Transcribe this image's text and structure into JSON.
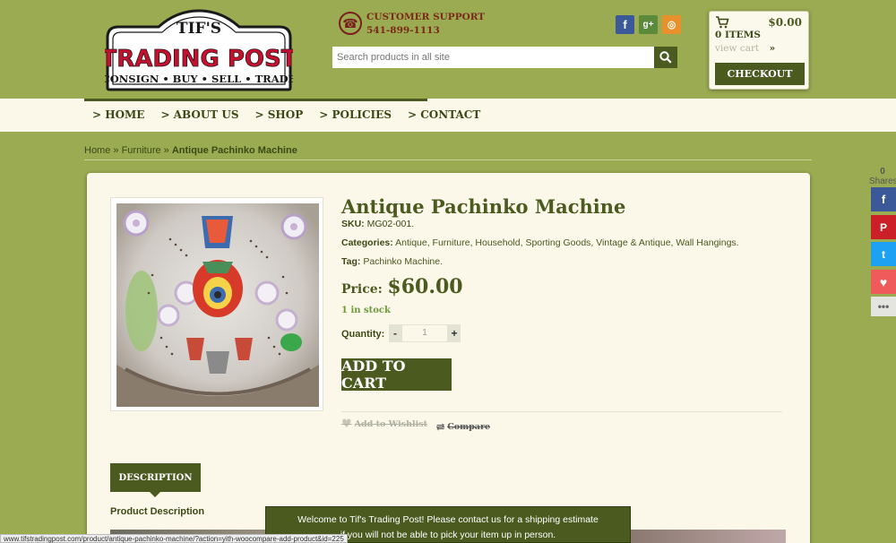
{
  "logo": {
    "line1": "TIF'S",
    "line2": "TRADING POST",
    "line3": "CONSIGN • BUY • SELL • TRADE"
  },
  "support": {
    "label": "CUSTOMER SUPPORT",
    "phone": "541-899-1113"
  },
  "search": {
    "placeholder": "Search products in all site"
  },
  "social": [
    "facebook",
    "google-plus",
    "rss"
  ],
  "cart": {
    "total": "$0.00",
    "items": "0 ITEMS",
    "view_cart": "view cart",
    "checkout": "CHECKOUT"
  },
  "nav": {
    "items": [
      "> HOME",
      "> ABOUT US",
      "> SHOP",
      "> POLICIES",
      "> CONTACT"
    ]
  },
  "breadcrumb": {
    "home": "Home",
    "sep1": " » ",
    "category": "Furniture",
    "sep2": " » ",
    "current": "Antique Pachinko Machine"
  },
  "product": {
    "title": "Antique Pachinko Machine",
    "sku_label": "SKU:",
    "sku": "MG02-001.",
    "categories_label": "Categories:",
    "categories": "Antique, Furniture, Household, Sporting Goods, Vintage & Antique, Wall Hangings.",
    "tag_label": "Tag:",
    "tag": "Pachinko Machine.",
    "price_label": "Price:",
    "price": "$60.00",
    "stock": "1 in stock",
    "quantity_label": "Quantity:",
    "quantity_minus": "-",
    "quantity_value": "1",
    "quantity_plus": "+",
    "add_to_cart": "ADD TO CART",
    "wishlist": "Add to Wishlist",
    "compare": "Compare"
  },
  "tabs": {
    "description": "DESCRIPTION",
    "heading": "Product Description"
  },
  "share": {
    "count": "0",
    "label": "Shares",
    "buttons": [
      "facebook",
      "pinterest",
      "twitter",
      "love",
      "more"
    ]
  },
  "notice": {
    "line1": "Welcome to Tif's Trading Post! Please contact us for a shipping estimate",
    "line2": "if you will not be able to pick your item up in person."
  },
  "status_url": "www.tifstradingpost.com/product/antique-pachinko-machine/?action=yith-woocompare-add-product&id=225",
  "colors": {
    "background": "#9aab52",
    "accent": "#4b5a1f",
    "cream": "#fbf7e9",
    "logo_red": "#c8102e"
  }
}
